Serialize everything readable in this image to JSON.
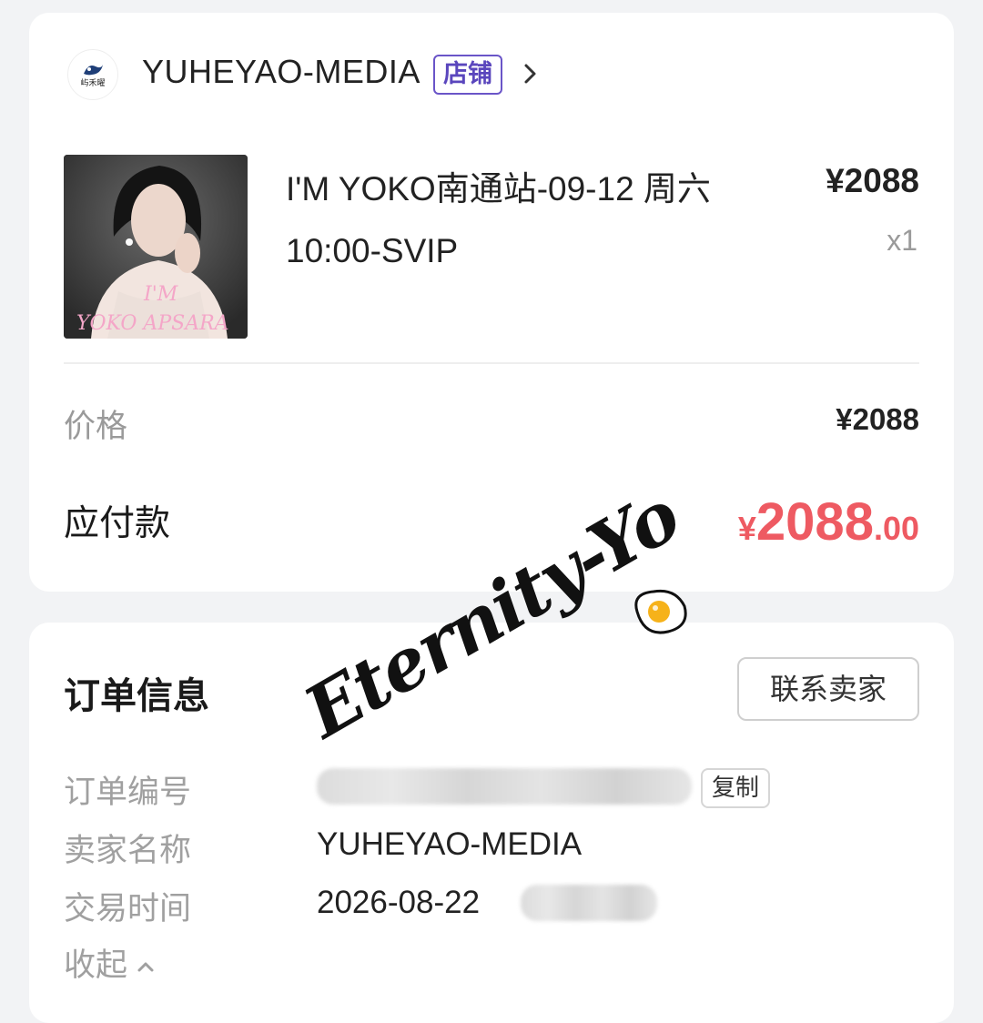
{
  "shop": {
    "logo_text": "屿禾曜",
    "name": "YUHEYAO-MEDIA",
    "badge": "店铺"
  },
  "product": {
    "title": "I'M YOKO南通站-09-12 周六 10:00-SVIP",
    "price": "¥2088",
    "quantity": "x1",
    "image_text_line1": "I'M",
    "image_text_line2": "YOKO APSARA"
  },
  "summary": {
    "price_label": "价格",
    "price_value": "¥2088",
    "payable_label": "应付款",
    "payable_currency": "¥",
    "payable_integer": "2088",
    "payable_decimal": ".00"
  },
  "order_info": {
    "title": "订单信息",
    "contact_seller": "联系卖家",
    "order_no_label": "订单编号",
    "copy_label": "复制",
    "seller_label": "卖家名称",
    "seller_value": "YUHEYAO-MEDIA",
    "time_label": "交易时间",
    "time_value": "2026-08-22",
    "collapse_label": "收起"
  },
  "watermark": {
    "text": "Eternity-Yo"
  },
  "colors": {
    "background": "#f2f3f5",
    "card": "#ffffff",
    "accent_price": "#ee5a62",
    "badge": "#5a46bd",
    "muted": "#9a9a9a"
  },
  "icons": [
    "shop-logo",
    "chevron-right-icon",
    "chevron-up-icon",
    "fried-egg-icon"
  ]
}
